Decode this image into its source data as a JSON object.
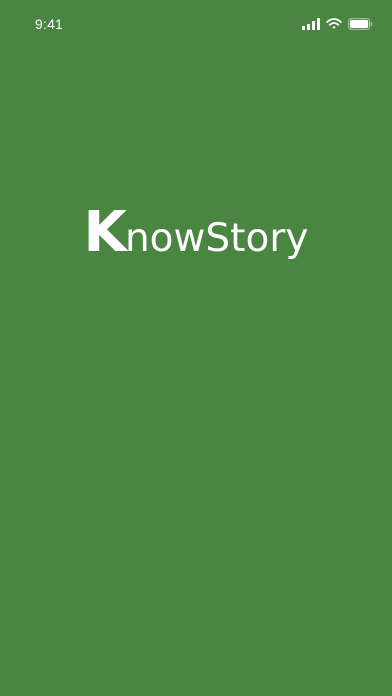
{
  "status_bar": {
    "time": "9:41",
    "icons": [
      "cellular-signal-icon",
      "wifi-icon",
      "battery-icon"
    ]
  },
  "splash": {
    "logo_initial": "K",
    "logo_rest": "nowStory"
  },
  "colors": {
    "background": "#4a8542",
    "foreground": "#ffffff"
  }
}
